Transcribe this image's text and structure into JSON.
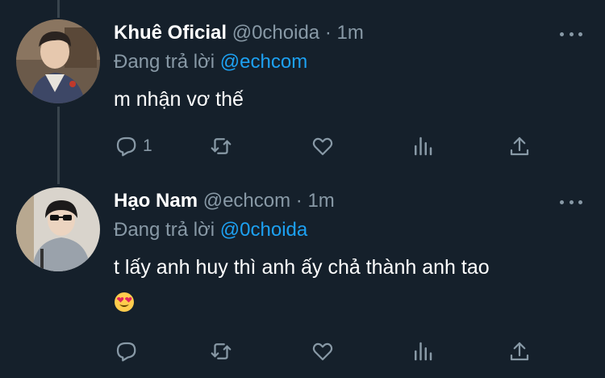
{
  "colors": {
    "background": "#15202b",
    "secondary_text": "#8899a6",
    "accent": "#1da1f2",
    "divider": "#38444d"
  },
  "tweets": [
    {
      "display_name": "Khuê Oficial",
      "handle": "@0choida",
      "separator": "·",
      "time": "1m",
      "replying_prefix": "Đang trả lời",
      "replying_to": "@echcom",
      "text": "m nhận vơ thế",
      "emoji": "",
      "reply_count": "1",
      "icons": [
        "reply-icon",
        "retweet-icon",
        "like-icon",
        "analytics-icon",
        "share-icon",
        "more-icon"
      ]
    },
    {
      "display_name": "Hạo Nam",
      "handle": "@echcom",
      "separator": "·",
      "time": "1m",
      "replying_prefix": "Đang trả lời",
      "replying_to": "@0choida",
      "text": "t lấy anh huy thì anh ấy chả thành anh tao",
      "emoji": "heart-eyes-emoji",
      "reply_count": "",
      "icons": [
        "reply-icon",
        "retweet-icon",
        "like-icon",
        "analytics-icon",
        "share-icon",
        "more-icon"
      ]
    }
  ]
}
